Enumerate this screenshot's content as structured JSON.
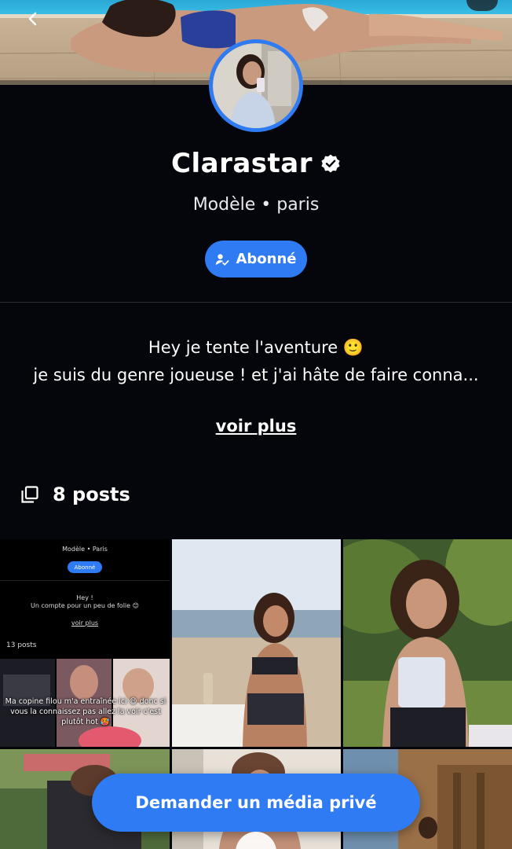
{
  "profile": {
    "name": "Clarastar",
    "verified": true,
    "subtitle": "Modèle • paris",
    "subscribe_label": "Abonné",
    "bio_line1": "Hey je tente l'aventure 🙂",
    "bio_line2": "je suis du genre joueuse ! et j'ai hâte de faire conna...",
    "see_more": "voir plus",
    "posts_count": "8 posts"
  },
  "grid_posts": [
    {
      "subtitle": "Modèle • Paris",
      "button": "Abonné",
      "bio1": "Hey !",
      "bio2": "Un compte pour un peu de folie 😊",
      "see_more": "voir plus",
      "count": "13 posts",
      "caption": "Ma copine filou m'a entraînée ici 😄 donc si vous la connaissez pas allez la voir c'est plutôt hot 🥵"
    }
  ],
  "cta": {
    "label": "Demander un média privé"
  },
  "colors": {
    "accent": "#2f7bf4",
    "background": "#05060b",
    "divider": "#2a2c36"
  }
}
